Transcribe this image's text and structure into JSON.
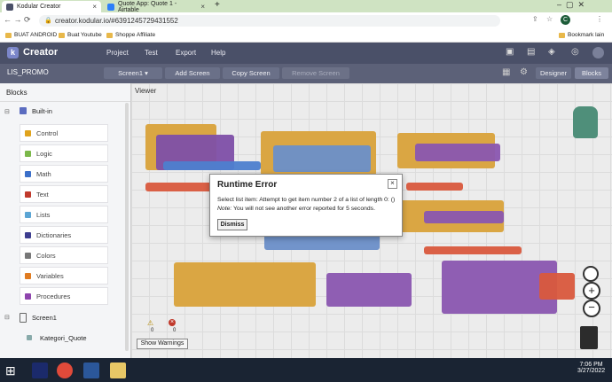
{
  "browser": {
    "tabs": [
      {
        "title": "Kodular Creator",
        "close": "×"
      },
      {
        "title": "Quote App: Quote 1 - Airtable",
        "close": "×"
      },
      {
        "new_tab": "+"
      }
    ],
    "url": "creator.kodular.io/#6391245729431552",
    "profile_initial": "C",
    "bookmarks": [
      "BUAT ANDROID",
      "Buat Youtube",
      "Shoppe Affiliate"
    ],
    "bookmarks_right": "Bookmark lain"
  },
  "app": {
    "brand": "Creator",
    "menu": [
      "Project",
      "Test",
      "Export",
      "Help"
    ],
    "toolbar": {
      "project": "LIS_PROMO",
      "screen": "Screen1",
      "add_screen": "Add Screen",
      "copy_screen": "Copy Screen",
      "remove_screen": "Remove Screen",
      "designer": "Designer",
      "blocks": "Blocks"
    },
    "blocks_title": "Blocks",
    "viewer_title": "Viewer",
    "builtin": "Built-in",
    "categories": [
      {
        "label": "Control",
        "color": "#e0a31c"
      },
      {
        "label": "Logic",
        "color": "#7bb84a"
      },
      {
        "label": "Math",
        "color": "#3b6fc9"
      },
      {
        "label": "Text",
        "color": "#c0392b"
      },
      {
        "label": "Lists",
        "color": "#5ba5d4"
      },
      {
        "label": "Dictionaries",
        "color": "#3d3d8f"
      },
      {
        "label": "Colors",
        "color": "#777777"
      },
      {
        "label": "Variables",
        "color": "#e07b20"
      },
      {
        "label": "Procedures",
        "color": "#8e44ad"
      }
    ],
    "screen_tree": {
      "screen": "Screen1",
      "child": "Kategori_Quote"
    },
    "warnings": {
      "count_a": "0",
      "count_b": "0",
      "button": "Show Warnings"
    }
  },
  "dialog": {
    "title": "Runtime Error",
    "message": "Select list item: Attempt to get item number 2 of a list of length 0: ()",
    "note_label": "Note:",
    "note_text": "You will not see another error reported for 5 seconds.",
    "dismiss": "Dismiss",
    "close": "×"
  },
  "taskbar": {
    "time": "7:06 PM",
    "date": "3/27/2022"
  }
}
